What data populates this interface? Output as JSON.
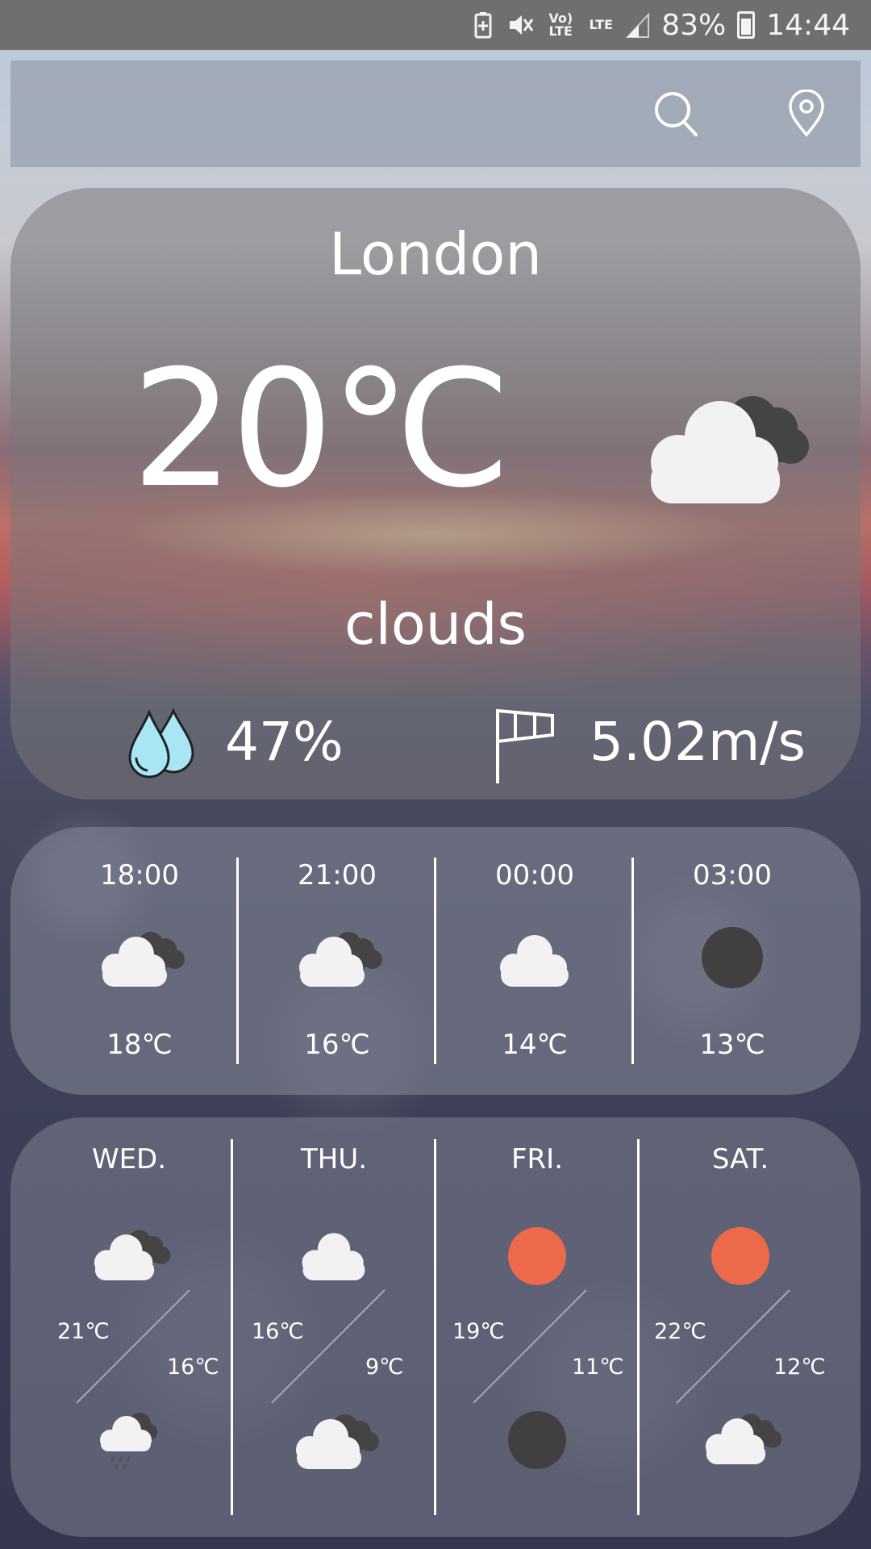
{
  "status_bar": {
    "volte": "Vo) LTE",
    "lte": "LTE",
    "battery": "83%",
    "time": "14:44"
  },
  "app_bar": {
    "search_icon": "search-icon",
    "location_icon": "location-pin-icon"
  },
  "current": {
    "city": "London",
    "temperature": "20℃",
    "condition": "clouds",
    "icon": "cloud-dark-cloud-icon",
    "humidity": "47%",
    "wind": "5.02m/s"
  },
  "hourly": [
    {
      "time": "18:00",
      "icon": "cloud-dark-cloud-icon",
      "temp": "18℃"
    },
    {
      "time": "21:00",
      "icon": "cloud-dark-cloud-icon",
      "temp": "16℃"
    },
    {
      "time": "00:00",
      "icon": "cloud-icon",
      "temp": "14℃"
    },
    {
      "time": "03:00",
      "icon": "clear-night-icon",
      "temp": "13℃"
    }
  ],
  "daily": [
    {
      "day": "WED.",
      "day_icon": "cloud-dark-cloud-icon",
      "high": "21℃",
      "low": "16℃",
      "night_icon": "rain-cloud-icon"
    },
    {
      "day": "THU.",
      "day_icon": "cloud-icon",
      "high": "16℃",
      "low": "9℃",
      "night_icon": "cloud-dark-cloud-icon"
    },
    {
      "day": "FRI.",
      "day_icon": "sun-icon",
      "high": "19℃",
      "low": "11℃",
      "night_icon": "clear-night-icon"
    },
    {
      "day": "SAT.",
      "day_icon": "sun-icon",
      "high": "22℃",
      "low": "12℃",
      "night_icon": "cloud-dark-cloud-icon"
    }
  ],
  "colors": {
    "sun": "#EC6A4A",
    "night": "#404040",
    "cloud": "#F2F2F2",
    "dark_cloud": "#444444",
    "drop": "#A8E6F6"
  }
}
